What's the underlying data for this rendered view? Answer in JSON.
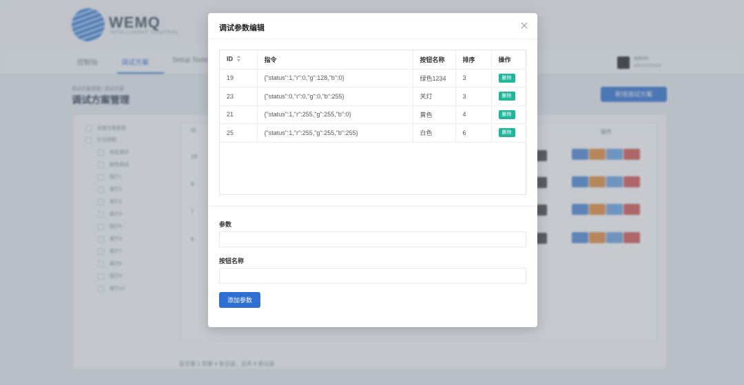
{
  "background": {
    "logo_text": "WEMQ",
    "logo_sub": "INTELLIGENT CONTROL",
    "nav": [
      "控制台",
      "调试方案",
      "Setup Tools"
    ],
    "user": {
      "name": "admin",
      "role": "administrator"
    },
    "breadcrumb": "调试方案管理 / 调试方案",
    "page_title": "调试方案管理",
    "add_button": "新增调试方案",
    "tree": [
      "全部方案类型",
      "灯光控制",
      "状态调试",
      "颜色调试",
      "客厅1",
      "客厅2",
      "客厅3",
      "客厅4",
      "客厅5",
      "客厅6",
      "客厅7",
      "客厅8",
      "客厅9",
      "客厅10"
    ],
    "table_first_col": [
      "19",
      "8",
      "7",
      "6"
    ],
    "header_col": "ID",
    "ops_header": "操作",
    "footer": "显示第 1 到第 4 条记录，总共 4 条记录"
  },
  "modal": {
    "title": "调试参数编辑",
    "columns": [
      "ID",
      "指令",
      "按钮名称",
      "排序",
      "操作"
    ],
    "rows": [
      {
        "id": "19",
        "command": "{\"status\":1,\"r\":0,\"g\":128,\"b\":0}",
        "name": "绿色1234",
        "order": "3",
        "action": "删除"
      },
      {
        "id": "23",
        "command": "{\"status\":0,\"r\":0,\"g\":0,\"b\":255}",
        "name": "关灯",
        "order": "3",
        "action": "删除"
      },
      {
        "id": "21",
        "command": "{\"status\":1,\"r\":255,\"g\":255,\"b\":0}",
        "name": "黄色",
        "order": "4",
        "action": "删除"
      },
      {
        "id": "25",
        "command": "{\"status\":1,\"r\":255,\"g\":255,\"b\":255}",
        "name": "白色",
        "order": "6",
        "action": "删除"
      }
    ],
    "param_label": "参数",
    "param_value": "",
    "button_name_label": "按钮名称",
    "button_name_value": "",
    "submit_label": "添加参数"
  },
  "colors": {
    "primary": "#2f6fd1",
    "delete": "#20b69a",
    "overlay": "#787f8c"
  }
}
